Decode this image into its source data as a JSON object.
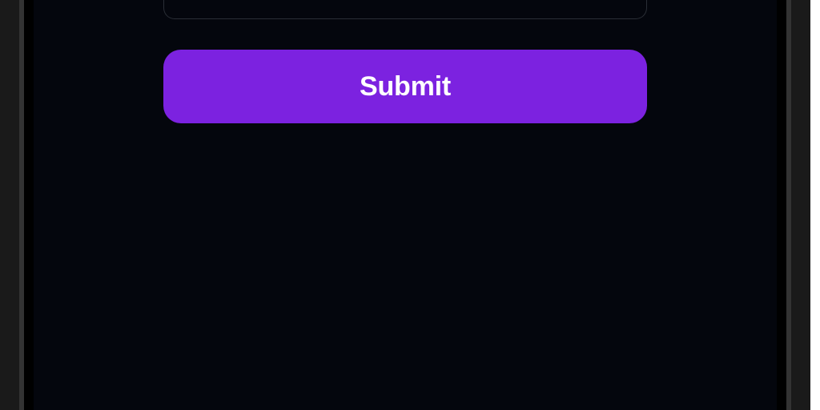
{
  "form": {
    "submit_label": "Submit"
  },
  "colors": {
    "accent": "#7c22e0",
    "screen_bg": "#04060d",
    "input_border": "#2a2e36"
  }
}
